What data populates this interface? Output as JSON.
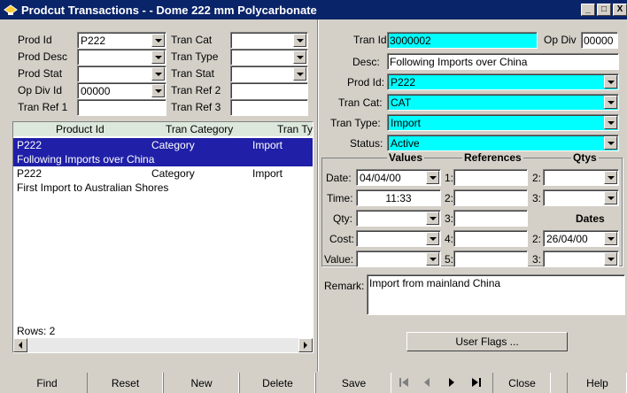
{
  "window": {
    "title": "Prodcut Transactions -  - Dome 222 mm Polycarbonate",
    "min": "_",
    "max": "□",
    "close": "X"
  },
  "filters": {
    "prod_id_label": "Prod Id",
    "prod_id_value": "P222",
    "prod_desc_label": "Prod Desc",
    "prod_desc_value": "",
    "prod_stat_label": "Prod Stat",
    "prod_stat_value": "",
    "op_div_id_label": "Op Div Id",
    "op_div_id_value": "00000",
    "tran_ref1_label": "Tran Ref 1",
    "tran_ref1_value": "",
    "tran_cat_label": "Tran Cat",
    "tran_cat_value": "",
    "tran_type_label": "Tran Type",
    "tran_type_value": "",
    "tran_stat_label": "Tran Stat",
    "tran_stat_value": "",
    "tran_ref2_label": "Tran Ref 2",
    "tran_ref2_value": "",
    "tran_ref3_label": "Tran Ref 3",
    "tran_ref3_value": ""
  },
  "grid": {
    "columns": [
      "Product Id",
      "Tran Category",
      "Tran Ty"
    ],
    "rows": [
      {
        "product": "P222",
        "category": "Category",
        "type": "Import",
        "desc": "Following Imports over China"
      },
      {
        "product": "P222",
        "category": "Category",
        "type": "Import",
        "desc": "First Import to Australian Shores"
      }
    ],
    "rows_label": "Rows: 2"
  },
  "detail": {
    "tran_id_label": "Tran Id:",
    "tran_id_value": "3000002",
    "op_div_label": "Op Div",
    "op_div_value": "00000",
    "desc_label": "Desc:",
    "desc_value": "Following Imports over China",
    "prod_id_label": "Prod Id:",
    "prod_id_value": "P222",
    "tran_cat_label": "Tran Cat:",
    "tran_cat_value": "CAT",
    "tran_type_label": "Tran Type:",
    "tran_type_value": "Import",
    "status_label": "Status:",
    "status_value": "Active",
    "values_header": "Values",
    "references_header": "References",
    "qtys_header": "Qtys",
    "dates_header": "Dates",
    "date_label": "Date:",
    "date_value": "04/04/00",
    "time_label": "Time:",
    "time_value": "11:33",
    "qty_label": "Qty:",
    "qty_value": "",
    "cost_label": "Cost:",
    "cost_value": "",
    "value_label": "Value:",
    "value_value": "",
    "ref1_label": "1:",
    "ref2_label": "2:",
    "ref3_label": "3:",
    "ref4_label": "4:",
    "ref5_label": "5:",
    "qty2_label": "2:",
    "qty3_label": "3:",
    "date2_label": "2:",
    "date2_value": "26/04/00",
    "date3_label": "3:",
    "date3_value": "",
    "remark_label": "Remark:",
    "remark_value": "Import from mainland China",
    "user_flags_label": "User Flags ..."
  },
  "toolbar": {
    "find": "Find",
    "reset": "Reset",
    "new": "New",
    "delete": "Delete",
    "save": "Save",
    "close": "Close",
    "help": "Help"
  }
}
